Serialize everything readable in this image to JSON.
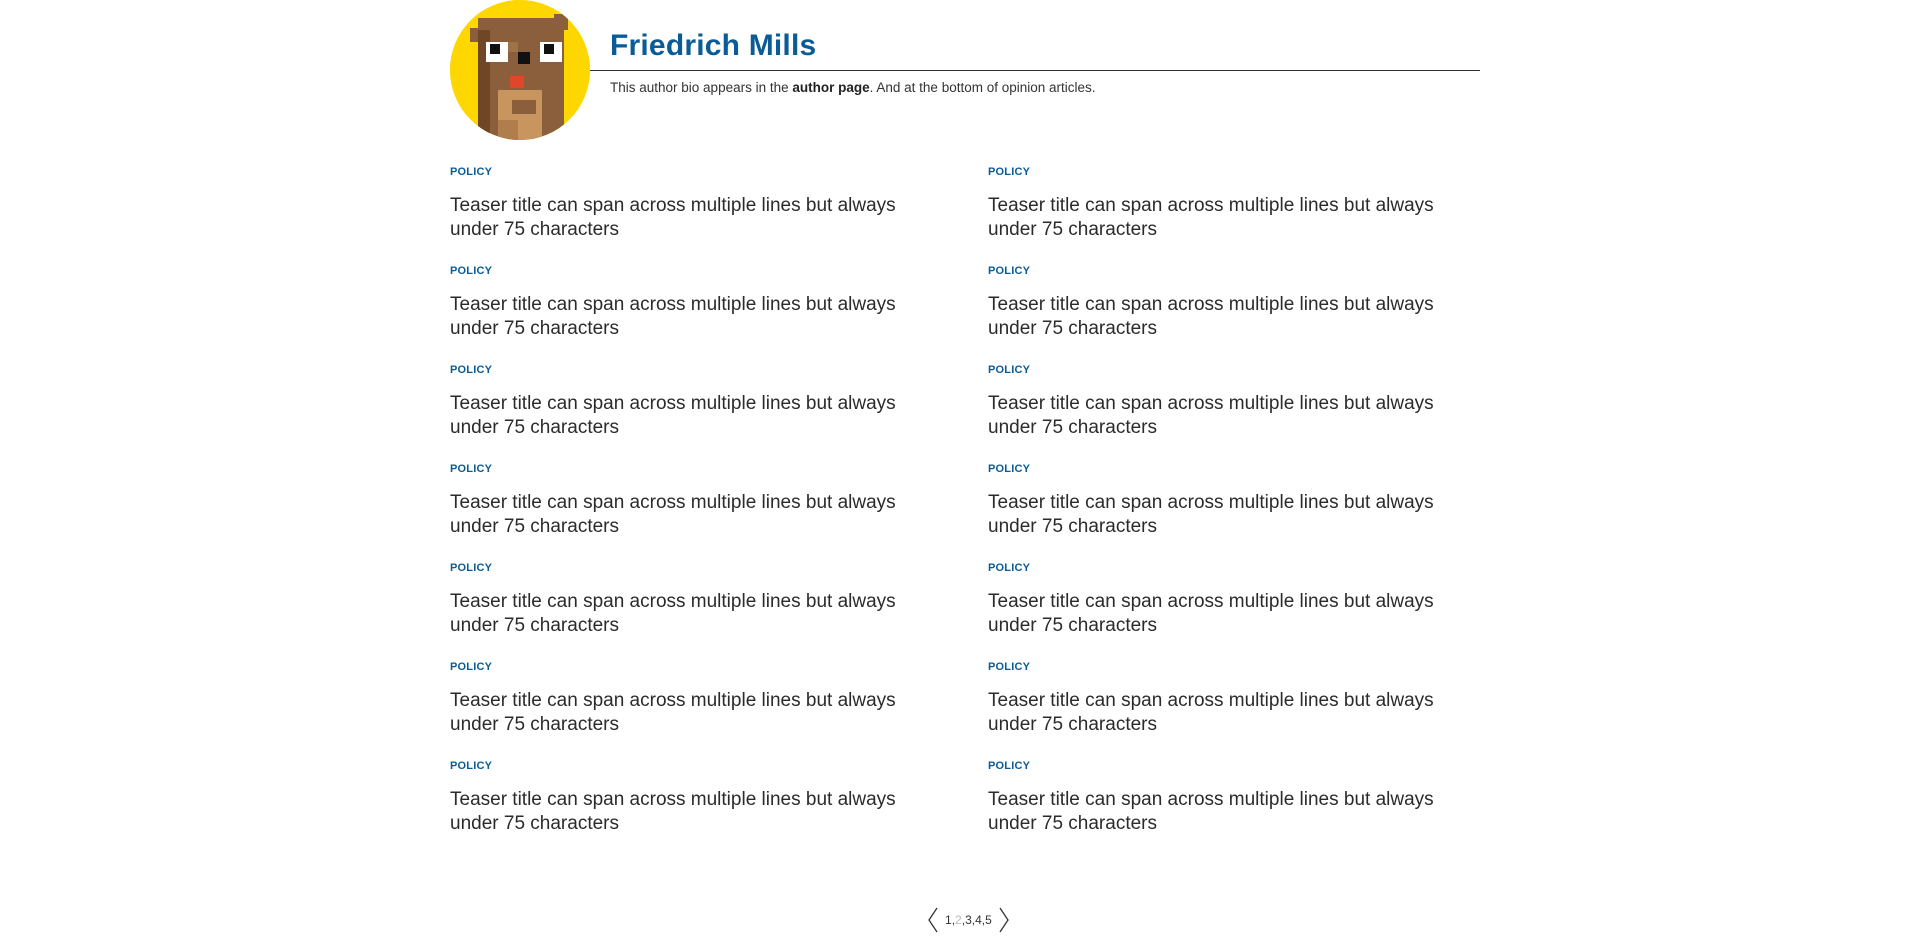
{
  "author": {
    "name": "Friedrich Mills",
    "bio_prefix": "This author bio appears in the ",
    "bio_link": "author page",
    "bio_suffix": ". And at the bottom of opinion articles.",
    "avatar_bg": "#FFD700"
  },
  "teasers": [
    {
      "tag": "POLICY",
      "title": "Teaser title can span across multiple lines but always under 75 characters"
    },
    {
      "tag": "POLICY",
      "title": "Teaser title can span across multiple lines but always under 75 characters"
    },
    {
      "tag": "POLICY",
      "title": "Teaser title can span across multiple lines but always under 75 characters"
    },
    {
      "tag": "POLICY",
      "title": "Teaser title can span across multiple lines but always under 75 characters"
    },
    {
      "tag": "POLICY",
      "title": "Teaser title can span across multiple lines but always under 75 characters"
    },
    {
      "tag": "POLICY",
      "title": "Teaser title can span across multiple lines but always under 75 characters"
    },
    {
      "tag": "POLICY",
      "title": "Teaser title can span across multiple lines but always under 75 characters"
    },
    {
      "tag": "POLICY",
      "title": "Teaser title can span across multiple lines but always under 75 characters"
    },
    {
      "tag": "POLICY",
      "title": "Teaser title can span across multiple lines but always under 75 characters"
    },
    {
      "tag": "POLICY",
      "title": "Teaser title can span across multiple lines but always under 75 characters"
    },
    {
      "tag": "POLICY",
      "title": "Teaser title can span across multiple lines but always under 75 characters"
    },
    {
      "tag": "POLICY",
      "title": "Teaser title can span across multiple lines but always under 75 characters"
    },
    {
      "tag": "POLICY",
      "title": "Teaser title can span across multiple lines but always under 75 characters"
    },
    {
      "tag": "POLICY",
      "title": "Teaser title can span across multiple lines but always under 75 characters"
    }
  ],
  "pagination": {
    "pages": [
      "1",
      "2",
      "3",
      "4",
      "5"
    ],
    "current": "2",
    "prev_icon": "chevron-left-icon",
    "next_icon": "chevron-right-icon"
  },
  "colors": {
    "accent": "#0b5c96",
    "text": "#2b2b2b",
    "current_page": "#bbbbbb"
  }
}
